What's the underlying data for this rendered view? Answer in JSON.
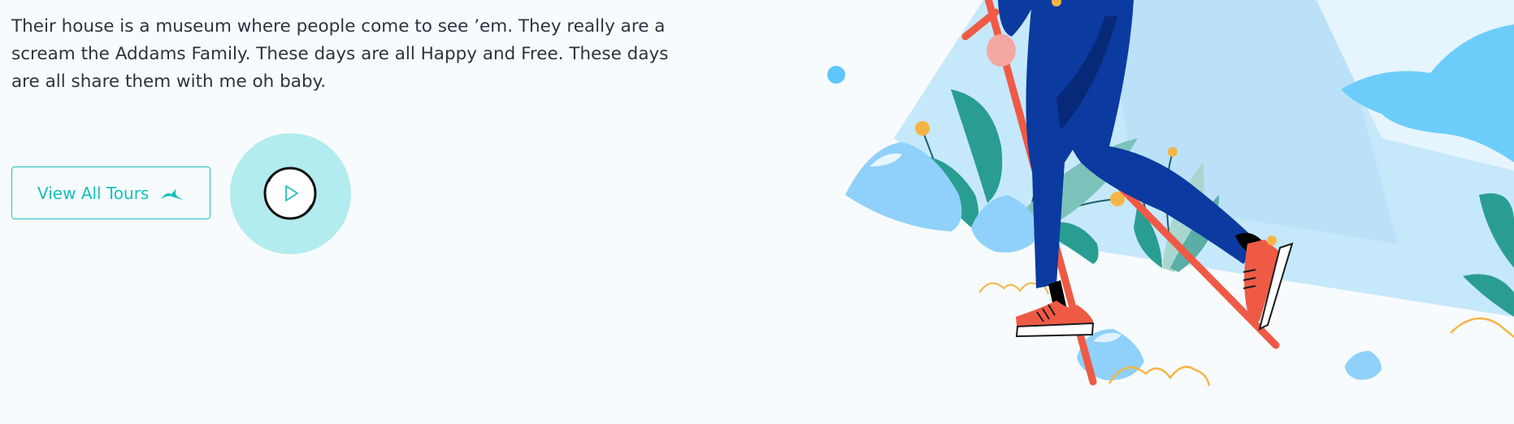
{
  "intro": {
    "text": "Their house is a museum where people come to see ’em. They really are a scream the Addams Family. These days are all Happy and Free. These days are all share them with me oh baby."
  },
  "cta": {
    "view_tours_label": "View All Tours",
    "icon": "bird-icon"
  },
  "video": {
    "icon": "play-icon"
  },
  "colors": {
    "accent": "#1ec5c2",
    "text": "#2b3441",
    "video_bg": "#b2ecee",
    "sky": "#c6e8fb",
    "pants": "#0b3aa0",
    "shoe": "#ef5a45",
    "leaf": "#2a9d92",
    "rock": "#8fd1fa",
    "flower": "#f5b544"
  },
  "illustration": {
    "name": "hiker-illustration"
  }
}
